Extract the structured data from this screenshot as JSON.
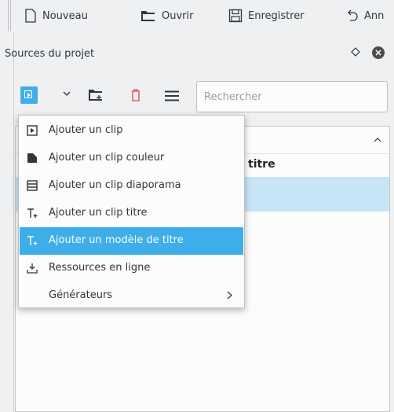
{
  "toolbar": {
    "new_label": "Nouveau",
    "open_label": "Ouvrir",
    "save_label": "Enregistrer",
    "undo_label": "Ann"
  },
  "dock": {
    "title": "Sources du projet"
  },
  "search": {
    "placeholder": "Rechercher"
  },
  "list": {
    "selected_row_text": "titre"
  },
  "menu": {
    "items": [
      {
        "label": "Ajouter un clip",
        "icon": "clip-icon"
      },
      {
        "label": "Ajouter un clip couleur",
        "icon": "color-clip-icon"
      },
      {
        "label": "Ajouter un clip diaporama",
        "icon": "slideshow-icon"
      },
      {
        "label": "Ajouter un clip titre",
        "icon": "title-clip-icon"
      },
      {
        "label": "Ajouter un modèle de titre",
        "icon": "title-template-icon",
        "highlighted": true
      },
      {
        "label": "Ressources en ligne",
        "icon": "download-icon"
      },
      {
        "label": "Générateurs",
        "icon": "",
        "submenu": true
      }
    ]
  },
  "colors": {
    "accent": "#3daee9",
    "selection": "#c8e4f7",
    "delete_red": "#da4453"
  }
}
